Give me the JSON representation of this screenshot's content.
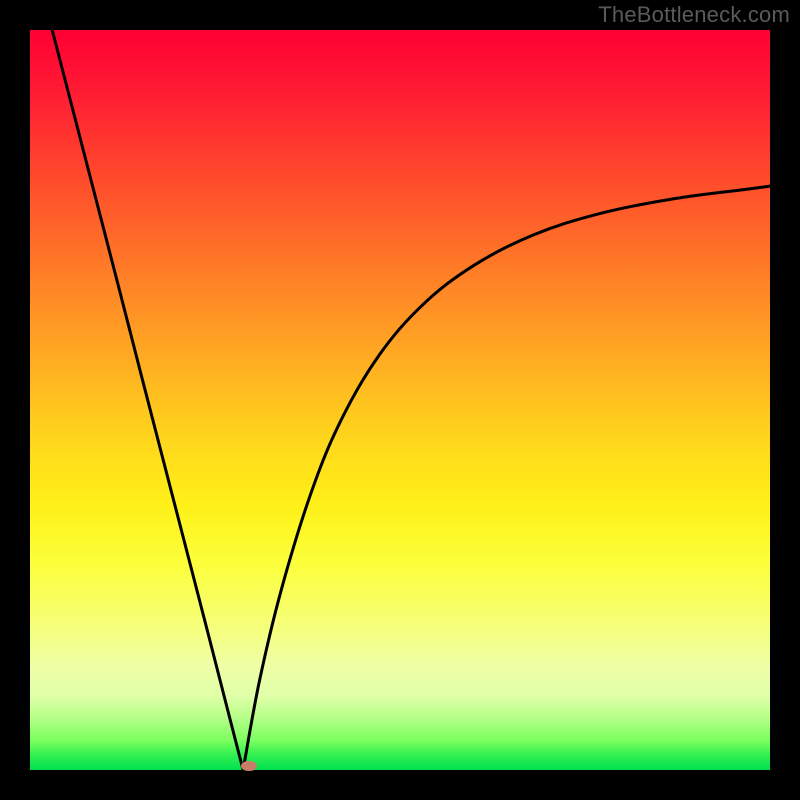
{
  "watermark": "TheBottleneck.com",
  "chart_data": {
    "type": "line",
    "title": "",
    "xlabel": "",
    "ylabel": "",
    "xlim": [
      0,
      1
    ],
    "ylim": [
      0,
      1
    ],
    "curve_min_x": 0.288,
    "marker": {
      "x": 0.296,
      "y": 0.005
    },
    "series": [
      {
        "name": "left_branch",
        "x": [
          0.03,
          0.06,
          0.09,
          0.12,
          0.15,
          0.18,
          0.21,
          0.24,
          0.27,
          0.288
        ],
        "y": [
          1.0,
          0.884,
          0.768,
          0.652,
          0.535,
          0.419,
          0.303,
          0.187,
          0.07,
          0.0
        ]
      },
      {
        "name": "right_branch",
        "x": [
          0.288,
          0.31,
          0.34,
          0.38,
          0.42,
          0.47,
          0.53,
          0.6,
          0.68,
          0.77,
          0.87,
          0.97,
          1.0
        ],
        "y": [
          0.0,
          0.12,
          0.245,
          0.375,
          0.472,
          0.558,
          0.628,
          0.682,
          0.723,
          0.752,
          0.772,
          0.785,
          0.789
        ]
      }
    ]
  },
  "colors": {
    "curve": "#000000",
    "marker": "#c97c67",
    "background_top": "#ff0033",
    "background_bottom": "#00e050"
  }
}
